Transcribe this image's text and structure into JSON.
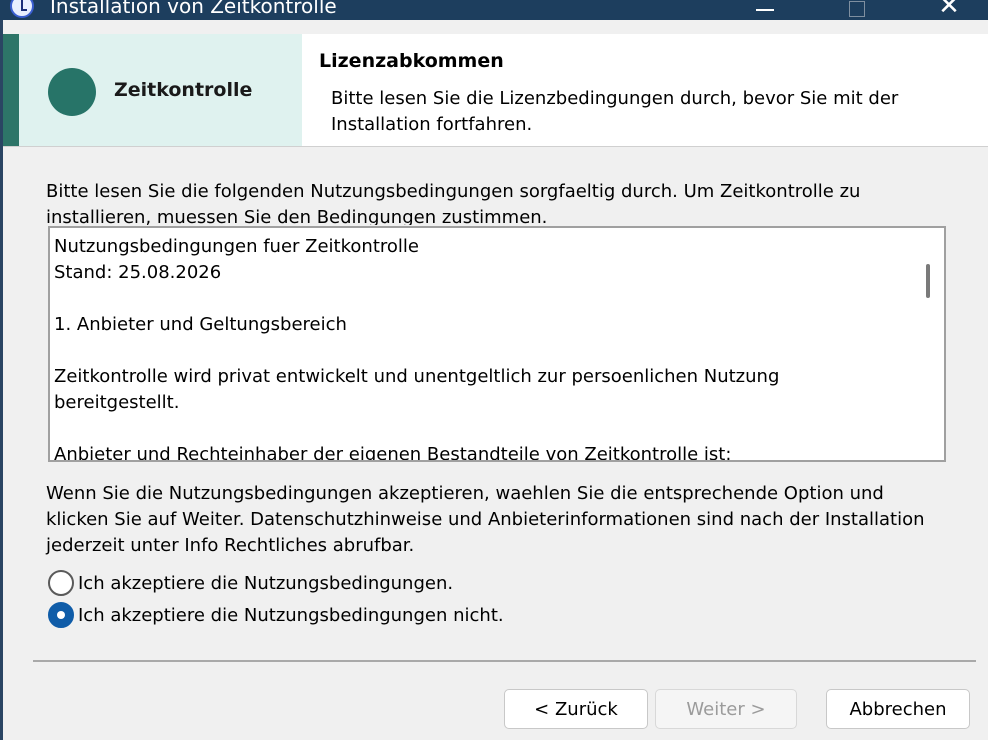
{
  "window": {
    "title": "Installation von Zeitkontrolle",
    "icon": "clock-icon",
    "controls": {
      "minimize": "minimize-icon",
      "maximize": "maximize-icon",
      "close": "✕"
    }
  },
  "header": {
    "brand_name": "Zeitkontrolle",
    "title": "Lizenzabkommen",
    "subtitle": "Bitte lesen Sie die Lizenzbedingungen durch, bevor Sie mit der Installation fortfahren."
  },
  "intro": "Bitte lesen Sie die folgenden Nutzungsbedingungen sorgfaeltig durch. Um Zeitkontrolle zu installieren, muessen Sie den Bedingungen zustimmen.",
  "license": {
    "lines": [
      "Nutzungsbedingungen fuer Zeitkontrolle",
      "Stand: 25.08.2026",
      "",
      "1. Anbieter und Geltungsbereich",
      "",
      "Zeitkontrolle wird privat entwickelt und unentgeltlich zur persoenlichen Nutzung bereitgestellt.",
      "",
      "Anbieter und Rechteinhaber der eigenen Bestandteile von Zeitkontrolle ist:"
    ]
  },
  "info": "Wenn Sie die Nutzungsbedingungen akzeptieren, waehlen Sie die entsprechende Option und klicken Sie auf Weiter. Datenschutzhinweise und Anbieterinformationen sind nach der Installation jederzeit unter Info  Rechtliches abrufbar.",
  "options": {
    "accept": {
      "label": "Ich akzeptiere die Nutzungsbedingungen.",
      "selected": false
    },
    "decline": {
      "label": "Ich akzeptiere die Nutzungsbedingungen nicht.",
      "selected": true
    }
  },
  "buttons": {
    "back": "< Zurück",
    "next": "Weiter >",
    "next_enabled": false,
    "cancel": "Abbrechen"
  },
  "colors": {
    "titlebar": "#1d3e5e",
    "brand_panel": "#dff2ef",
    "brand_accent": "#277468",
    "radio_selected": "#0f5ca8"
  }
}
